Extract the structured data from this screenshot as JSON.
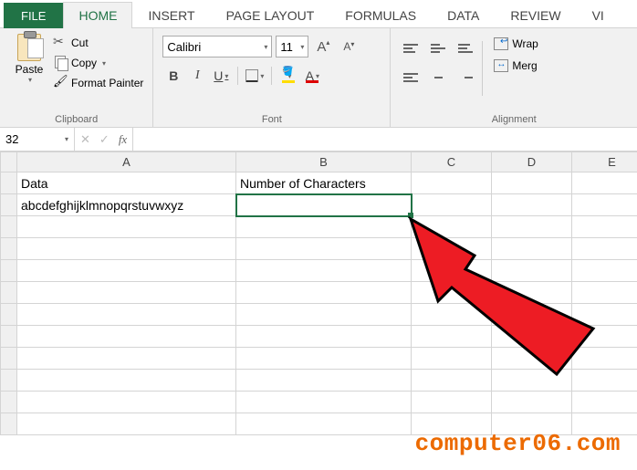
{
  "tabs": {
    "file": "FILE",
    "home": "HOME",
    "insert": "INSERT",
    "page_layout": "PAGE LAYOUT",
    "formulas": "FORMULAS",
    "data": "DATA",
    "review": "REVIEW",
    "view_partial": "VI"
  },
  "clipboard": {
    "paste": "Paste",
    "cut": "Cut",
    "copy": "Copy",
    "format_painter": "Format Painter",
    "group_title": "Clipboard"
  },
  "font": {
    "name": "Calibri",
    "size": "11",
    "bold": "B",
    "italic": "I",
    "underline": "U",
    "grow": "A",
    "shrink": "A",
    "fill_letter": "A",
    "color_letter": "A",
    "group_title": "Font"
  },
  "alignment": {
    "wrap": "Wrap",
    "merge": "Merg",
    "group_title": "Alignment"
  },
  "namebox": "32",
  "fx_label": "fx",
  "columns": [
    "A",
    "B",
    "C",
    "D",
    "E"
  ],
  "cells": {
    "A1": "Data",
    "B1": "Number of Characters",
    "A2": "abcdefghijklmnopqrstuvwxyz"
  },
  "watermark": "computer06.com"
}
